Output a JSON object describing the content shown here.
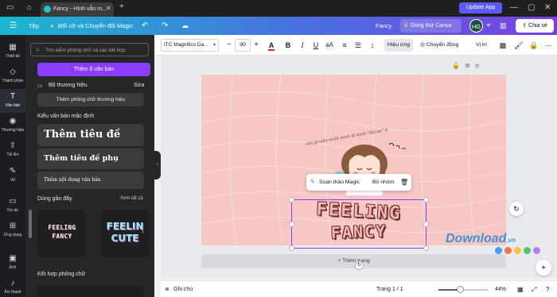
{
  "browser": {
    "tab_title": "Fancy - Hình vẫn m...",
    "update_label": "Update App"
  },
  "header": {
    "file_label": "Tệp",
    "resize_label": "Đổi cỡ và Chuyển đổi Magic",
    "doc_title": "Fancy",
    "pro_label": "Dùng thử Canva Pro",
    "avatar_initials": "HG",
    "share_label": "Chia sẻ"
  },
  "rail": [
    {
      "icon": "layout-icon",
      "glyph": "▦",
      "label": "Thiết kế"
    },
    {
      "icon": "elements-icon",
      "glyph": "◇",
      "label": "Thành phần"
    },
    {
      "icon": "text-icon",
      "glyph": "T",
      "label": "Văn bản"
    },
    {
      "icon": "brand-icon",
      "glyph": "◉",
      "label": "Thương hiệu"
    },
    {
      "icon": "upload-icon",
      "glyph": "⇧",
      "label": "Tải lên"
    },
    {
      "icon": "draw-icon",
      "glyph": "✎",
      "label": "Vẽ"
    },
    {
      "icon": "projects-icon",
      "glyph": "▭",
      "label": "Dự án"
    },
    {
      "icon": "apps-icon",
      "glyph": "⊞",
      "label": "Ứng dụng"
    },
    {
      "icon": "photos-icon",
      "glyph": "▣",
      "label": "Ảnh"
    },
    {
      "icon": "audio-icon",
      "glyph": "♪",
      "label": "Âm thanh"
    }
  ],
  "panel": {
    "search_placeholder": "Tìm kiếm phông chữ và các kết hợp",
    "add_text_label": "Thêm ô văn bản",
    "brand_kit_label": "Bộ thương hiệu",
    "brand_kit_edit": "Sửa",
    "brand_font_label": "Thêm phông chữ thương hiệu",
    "default_styles_title": "Kiểu văn bản mặc định",
    "heading_label": "Thêm tiêu đề",
    "subheading_label": "Thêm tiêu đề phụ",
    "body_label": "Thêm nội dung văn bản",
    "recent_title": "Dùng gần đây",
    "recent_see_all": "Xem tất cả",
    "recent_items": [
      {
        "line1": "FEELING",
        "line2": "FANCY"
      },
      {
        "line1": "FEELIN",
        "line2": "CUTE"
      }
    ],
    "combos_title": "Kết hợp phông chữ"
  },
  "toolbar": {
    "font_name": "ITC Magnifico Da...",
    "font_size": "90",
    "effects_label": "Hiệu ứng",
    "animate_label": "Chuyển động",
    "position_label": "Vị trí"
  },
  "canvas": {
    "handwritten": "cần gì nắm nanh mình lắ mình “lấp pa” tí",
    "art_line1": "FEELING",
    "art_line2": "FANCY",
    "edit_magic_label": "Soạn thảo Magic",
    "ungroup_label": "Bỏ nhóm",
    "add_page_label": "+ Thêm trang"
  },
  "footer": {
    "notes_label": "Ghi chú",
    "page_indicator": "Trang 1 / 1",
    "zoom_percent": "44%",
    "zoom_fraction": 0.44
  },
  "watermark": {
    "text": "Download",
    "suffix": ".vn",
    "dot_colors": [
      "#3fa2f7",
      "#f2744a",
      "#f6c33b",
      "#59c36a",
      "#b27ef2"
    ]
  },
  "colors": {
    "accent": "#8b3dff",
    "page_background": "#f6c7c3",
    "art_fill": "#f3b6b4",
    "art_shadow": "#6b2f2c"
  }
}
